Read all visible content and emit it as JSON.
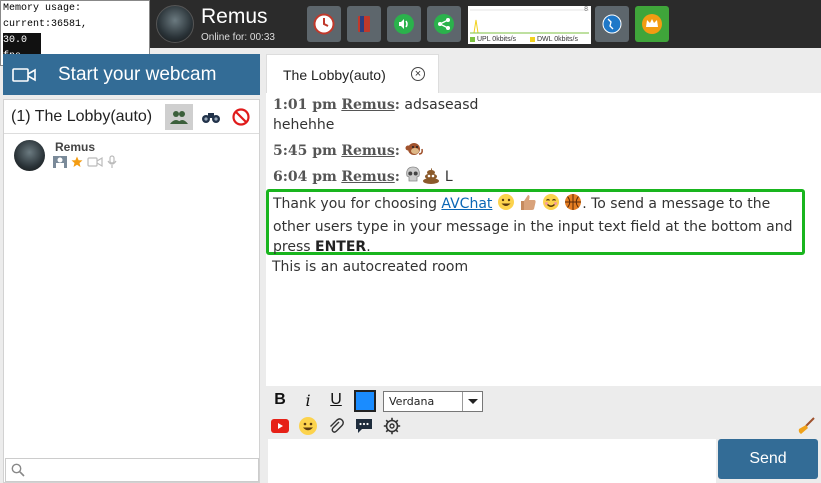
{
  "status": {
    "memory_text": "Memory usage: current:36581,",
    "fps_text": "30.0 fps"
  },
  "header": {
    "user_name": "Remus",
    "online_text": "Online for: 00:33",
    "graph": {
      "max_label": "8",
      "upload_label": "UPL 0kbits/s",
      "download_label": "DWL 0kbits/s",
      "upload_color": "#7dc241",
      "download_color": "#f2d21f"
    },
    "buttons": [
      {
        "name": "clock-icon",
        "color": "#5d666c"
      },
      {
        "name": "book-icon",
        "color": "#5d666c"
      },
      {
        "name": "speaker-icon",
        "color": "#5d666c"
      },
      {
        "name": "share-icon",
        "color": "#5d666c"
      },
      {
        "name": "globe-icon",
        "color": "#5d666c"
      },
      {
        "name": "crown-icon",
        "color": "#3fa53a"
      }
    ]
  },
  "sidebar": {
    "webcam_label": "Start your webcam",
    "room_title": "(1) The Lobby(auto)",
    "users": [
      {
        "name": "Remus",
        "badges": [
          "flag-icon",
          "star-icon",
          "camera-icon",
          "microphone-icon"
        ]
      }
    ],
    "search_placeholder": ""
  },
  "tab": {
    "label": "The Lobby(auto)"
  },
  "chat": {
    "messages": [
      {
        "time": "1:01 pm",
        "user": "Remus",
        "colon": ":",
        "text": "adsaseasd",
        "continuation": "hehehhe"
      },
      {
        "time": "5:45 pm",
        "user": "Remus",
        "colon": ":",
        "emoji": "monkey"
      },
      {
        "time": "6:04 pm",
        "user": "Remus",
        "colon": ":",
        "emoji": "skull, poop",
        "text": "L"
      }
    ],
    "welcome": {
      "prefix": "Thank you for choosing ",
      "link": "AVChat",
      "mid": ". To send a message to the other users type in your message in the input text field at the bottom and press ",
      "bold": "ENTER",
      "suffix": "."
    },
    "autocreated": "This is an autocreated room"
  },
  "composer": {
    "bold_label": "B",
    "italic_label": "i",
    "underline_label": "U",
    "text_color": "#1a8cff",
    "font_value": "Verdana",
    "input_value": "",
    "send_label": "Send"
  },
  "colors": {
    "accent": "#336c96",
    "welcome_border": "#19b51e",
    "link": "#0a66b5"
  }
}
